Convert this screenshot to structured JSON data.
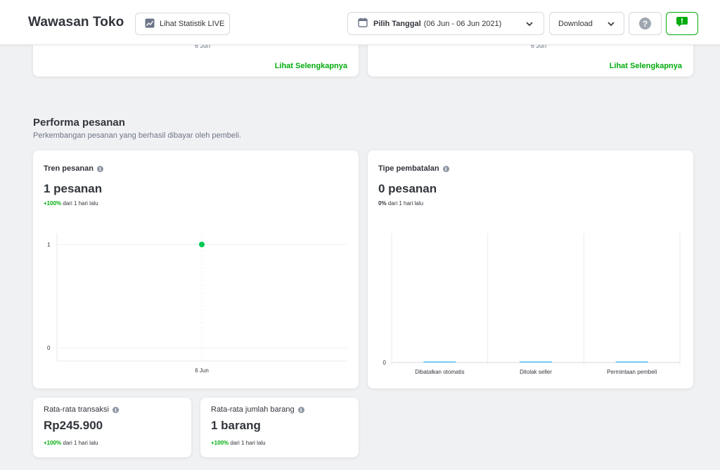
{
  "header": {
    "brand": "Wawasan Toko",
    "live_button": "Lihat Statistik LIVE",
    "date_label": "Pilih Tanggal",
    "date_range": "(06 Jun - 06 Jun 2021)",
    "download_label": "Download",
    "help_glyph": "?"
  },
  "top_cards": [
    {
      "date_label": "6 Jun",
      "link": "Lihat Selengkapnya"
    },
    {
      "date_label": "6 Jun",
      "link": "Lihat Selengkapnya"
    }
  ],
  "section": {
    "title": "Performa pesanan",
    "subtitle": "Perkembangan pesanan yang berhasil dibayar oleh pembeli."
  },
  "tren": {
    "title": "Tren pesanan",
    "value": "1 pesanan",
    "delta": "+100%",
    "delta_text": "dari 1 hari lalu"
  },
  "pembatalan": {
    "title": "Tipe pembatalan",
    "value": "0 pesanan",
    "delta": "0%",
    "delta_text": "dari 1 hari lalu"
  },
  "rata_transaksi": {
    "title": "Rata-rata transaksi",
    "value": "Rp245.900",
    "delta": "+100%",
    "delta_text": "dari 1 hari lalu"
  },
  "rata_barang": {
    "title": "Rata-rata jumlah barang",
    "value": "1 barang",
    "delta": "+100%",
    "delta_text": "dari 1 hari lalu"
  },
  "colors": {
    "accent": "#03ac0e",
    "point": "#00c853",
    "bar": "#4fc3f7"
  },
  "chart_data": [
    {
      "type": "line",
      "x": [
        "6 Jun"
      ],
      "series": [
        {
          "values": [
            1
          ]
        }
      ],
      "ylim": [
        0,
        1
      ],
      "yticks": [
        0,
        1
      ],
      "grid": true
    },
    {
      "type": "bar",
      "categories": [
        "Dibatalkan otomatis",
        "Ditolak seller",
        "Permintaan pembeli"
      ],
      "values": [
        0,
        0,
        0
      ],
      "yticks": [
        0
      ],
      "grid": true
    }
  ]
}
